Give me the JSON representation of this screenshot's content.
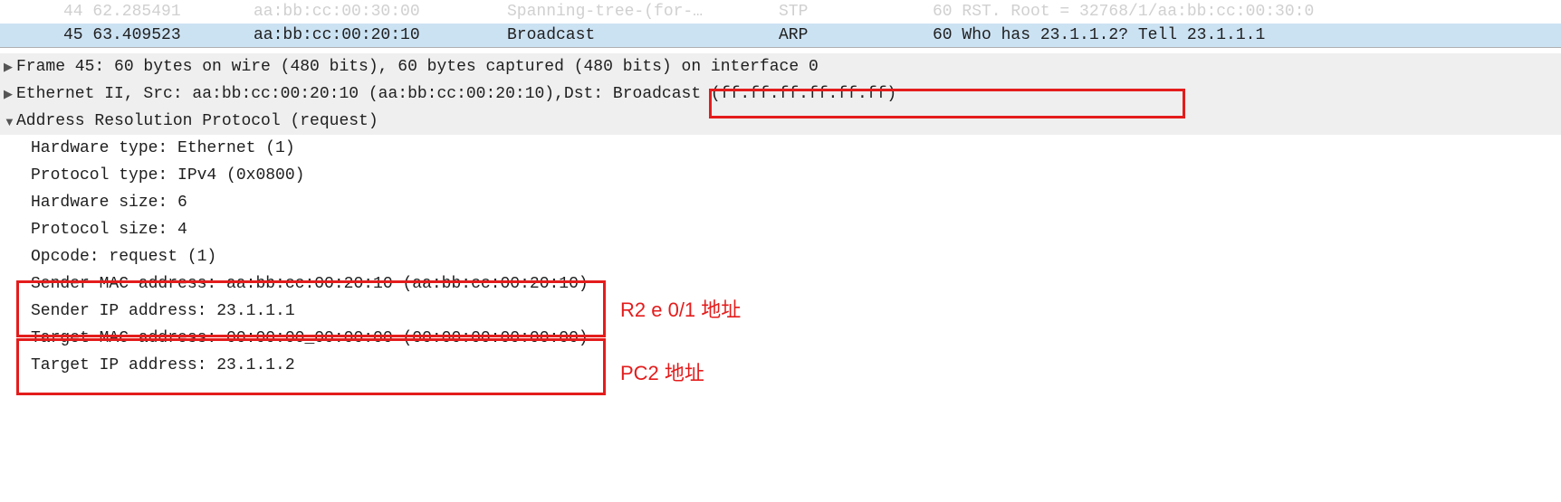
{
  "packets": {
    "prev": {
      "no": "44 62.285491",
      "src": "aa:bb:cc:00:30:00",
      "dst": "Spanning-tree-(for-…",
      "proto": "STP",
      "info": "60 RST. Root = 32768/1/aa:bb:cc:00:30:0"
    },
    "sel": {
      "no": "45 63.409523",
      "src": "aa:bb:cc:00:20:10",
      "dst": "Broadcast",
      "proto": "ARP",
      "info": "60 Who has 23.1.1.2? Tell 23.1.1.1"
    }
  },
  "details": {
    "frame": "Frame 45: 60 bytes on wire (480 bits), 60 bytes captured (480 bits) on interface 0",
    "eth_pre": "Ethernet II, Src: aa:bb:cc:00:20:10 (aa:bb:cc:00:20:10),",
    "eth_dst": " Dst: Broadcast (ff:ff:ff:ff:ff:ff)",
    "arp_header": "Address Resolution Protocol (request)",
    "hw_type": "Hardware type: Ethernet (1)",
    "proto_type": "Protocol type: IPv4 (0x0800)",
    "hw_size": "Hardware size: 6",
    "proto_size": "Protocol size: 4",
    "opcode": "Opcode: request (1)",
    "sender_mac": "Sender MAC address: aa:bb:cc:00:20:10 (aa:bb:cc:00:20:10)",
    "sender_ip": "Sender IP address: 23.1.1.1",
    "target_mac": "Target MAC address: 00:00:00_00:00:00 (00:00:00:00:00:00)",
    "target_ip": "Target IP address: 23.1.1.2"
  },
  "annotations": {
    "r2": "R2 e 0/1 地址",
    "pc2": "PC2 地址"
  },
  "glyphs": {
    "right": "▶",
    "down": "▼"
  }
}
